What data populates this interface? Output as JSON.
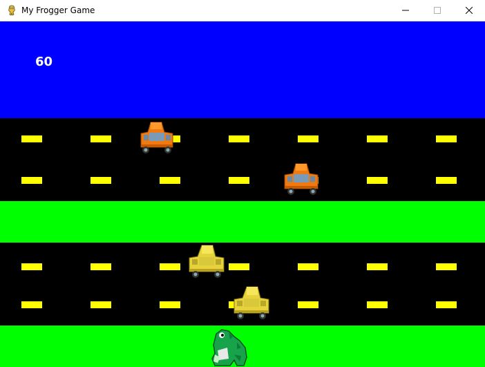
{
  "window": {
    "title": "My Frogger Game",
    "icons": {
      "app": "pygame-snake-icon",
      "minimize": "minimize-icon",
      "maximize": "maximize-icon",
      "close": "close-icon"
    }
  },
  "game": {
    "score": "60",
    "colors": {
      "water": "#0000ff",
      "road": "#000000",
      "grass": "#00ff00",
      "lane_marking": "#ffff00",
      "score_text": "#ffffff"
    },
    "cars": [
      {
        "name": "orange-car-1",
        "color": "orange"
      },
      {
        "name": "orange-car-2",
        "color": "orange"
      },
      {
        "name": "yellow-car-1",
        "color": "yellow"
      },
      {
        "name": "yellow-car-2",
        "color": "yellow"
      }
    ],
    "player": "frog"
  }
}
